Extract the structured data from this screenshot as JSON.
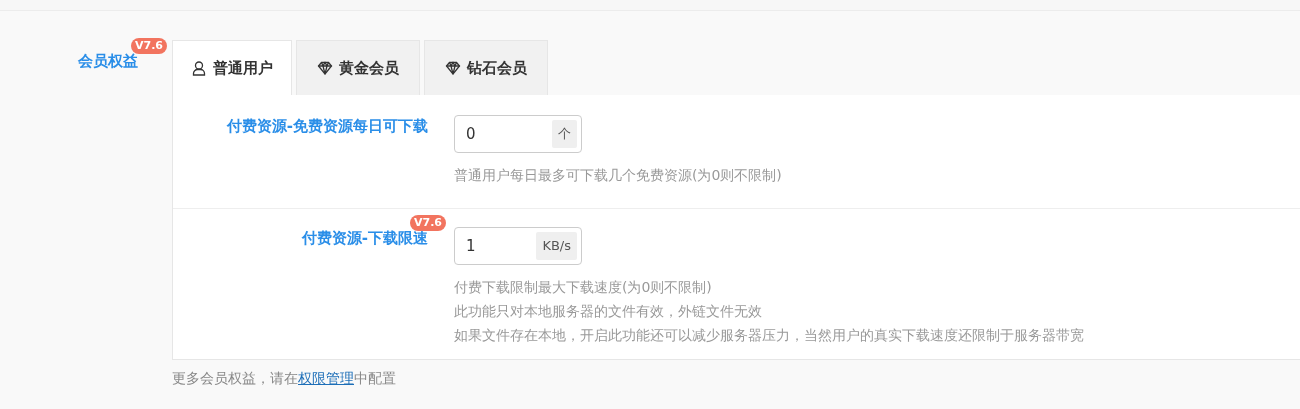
{
  "section": {
    "label": "会员权益",
    "badge": "V7.6"
  },
  "tabs": [
    {
      "label": "普通用户",
      "kind": "user",
      "selected": true
    },
    {
      "label": "黄金会员",
      "kind": "diamond",
      "selected": false
    },
    {
      "label": "钻石会员",
      "kind": "diamond",
      "selected": false
    }
  ],
  "fields": [
    {
      "label": "付费资源-免费资源每日可下载",
      "value": "0",
      "unit": "个",
      "hints": [
        "普通用户每日最多可下载几个免费资源(为0则不限制)"
      ]
    },
    {
      "label": "付费资源-下载限速",
      "badge": "V7.6",
      "value": "1",
      "unit": "KB/s",
      "hints": [
        "付费下载限制最大下载速度(为0则不限制)",
        "此功能只对本地服务器的文件有效，外链文件无效",
        "如果文件存在本地，开启此功能还可以减少服务器压力，当然用户的真实下载速度还限制于服务器带宽"
      ]
    }
  ],
  "footer": {
    "before": "更多会员权益，请在",
    "link": "权限管理",
    "after": "中配置"
  }
}
